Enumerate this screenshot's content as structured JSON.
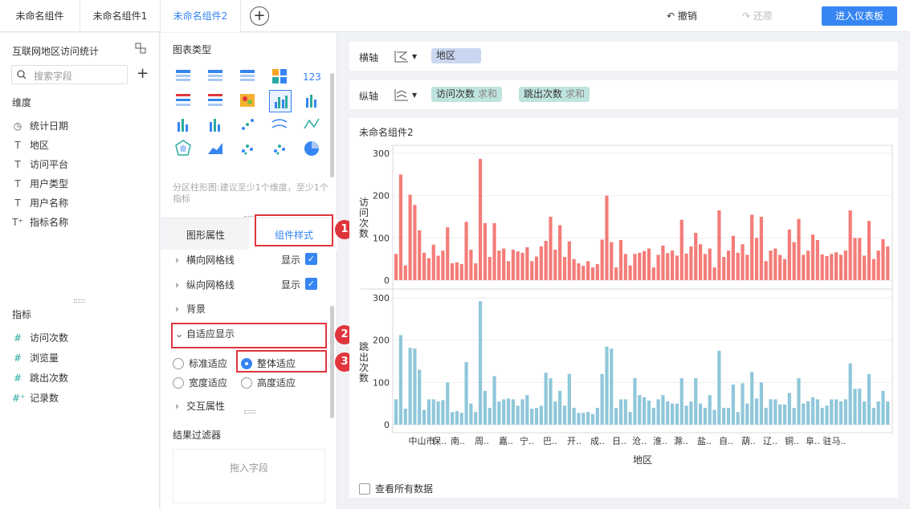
{
  "tabs": [
    "未命名组件",
    "未命名组件1",
    "未命名组件2"
  ],
  "active_tab": 2,
  "toolbar": {
    "undo": "撤销",
    "redo": "还原",
    "enter": "进入仪表板"
  },
  "left": {
    "dataset": "互联网地区访问统计",
    "search_placeholder": "搜索字段",
    "dimensions_title": "维度",
    "dimensions": [
      {
        "icon": "clock-icon",
        "glyph": "◷",
        "label": "统计日期"
      },
      {
        "icon": "text-icon",
        "glyph": "T",
        "label": "地区"
      },
      {
        "icon": "text-icon",
        "glyph": "T",
        "label": "访问平台"
      },
      {
        "icon": "text-icon",
        "glyph": "T",
        "label": "用户类型"
      },
      {
        "icon": "text-icon",
        "glyph": "T",
        "label": "用户名称"
      },
      {
        "icon": "text-plus-icon",
        "glyph": "T⁺",
        "label": "指标名称"
      }
    ],
    "measures_title": "指标",
    "measures": [
      {
        "icon": "hash-icon",
        "glyph": "#",
        "label": "访问次数"
      },
      {
        "icon": "hash-icon",
        "glyph": "#",
        "label": "浏览量"
      },
      {
        "icon": "hash-icon",
        "glyph": "#",
        "label": "跳出次数"
      },
      {
        "icon": "hash-plus-icon",
        "glyph": "#⁺",
        "label": "记录数"
      }
    ]
  },
  "middle": {
    "chart_type_title": "图表类型",
    "hint": "分区柱形图:建议至少1个维度，至少1个指标",
    "tab_props": "图形属性",
    "tab_style": "组件样式",
    "props": {
      "h_grid": "横向网格线",
      "v_grid": "纵向网格线",
      "show": "显示",
      "background": "背景",
      "adaptive": "自适应显示",
      "opt_standard": "标准适应",
      "opt_whole": "整体适应",
      "opt_width": "宽度适应",
      "opt_height": "高度适应",
      "interaction": "交互属性"
    },
    "filter_title": "结果过滤器",
    "drop_hint": "拖入字段"
  },
  "badges": [
    "1",
    "2",
    "3"
  ],
  "axes": {
    "x_label": "横轴",
    "x_field": "地区",
    "y_label": "纵轴",
    "y_fields": [
      {
        "name": "访问次数",
        "agg": "求和"
      },
      {
        "name": "跳出次数",
        "agg": "求和"
      }
    ]
  },
  "chart_title": "未命名组件2",
  "see_all": "查看所有数据",
  "colors": {
    "accent": "#3685f2",
    "bar_top": "#f47c78",
    "bar_bottom": "#8fc7da",
    "badge": "#e0353d"
  },
  "chart_data": {
    "type": "bar",
    "title": "未命名组件2",
    "xlabel": "地区",
    "panels": [
      {
        "ylabel": "访问次数",
        "ylim": [
          0,
          300
        ],
        "yticks": [
          0,
          100,
          200,
          300
        ]
      },
      {
        "ylabel": "跳出次数",
        "ylim": [
          0,
          300
        ],
        "yticks": [
          0,
          100,
          200,
          300
        ]
      }
    ],
    "x_tick_labels": [
      "中山市",
      "保..",
      "南..",
      "周..",
      "嘉..",
      "宁..",
      "巴..",
      "开..",
      "成..",
      "日..",
      "沧..",
      "淮..",
      "滁..",
      "盐..",
      "自..",
      "葫..",
      "辽..",
      "铜..",
      "阜..",
      "驻马.."
    ],
    "series": [
      {
        "name": "访问次数",
        "values": [
          62,
          250,
          35,
          202,
          178,
          118,
          65,
          52,
          84,
          58,
          70,
          125,
          40,
          42,
          38,
          138,
          72,
          40,
          287,
          135,
          55,
          135,
          70,
          75,
          45,
          72,
          68,
          65,
          78,
          45,
          56,
          80,
          93,
          150,
          72,
          130,
          55,
          92,
          50,
          40,
          34,
          45,
          30,
          38,
          96,
          200,
          90,
          30,
          95,
          62,
          35,
          62,
          65,
          69,
          75,
          30,
          60,
          82,
          64,
          70,
          58,
          143,
          63,
          80,
          112,
          85,
          62,
          75,
          30,
          165,
          55,
          70,
          105,
          65,
          85,
          60,
          155,
          100,
          150,
          45,
          70,
          75,
          60,
          50,
          120,
          90,
          145,
          60,
          70,
          108,
          95,
          61,
          57,
          62,
          66,
          60,
          70,
          165,
          100,
          100,
          58,
          140,
          50,
          70,
          97,
          80
        ]
      },
      {
        "name": "跳出次数",
        "values": [
          60,
          212,
          38,
          182,
          180,
          130,
          35,
          60,
          60,
          55,
          58,
          100,
          30,
          32,
          28,
          148,
          50,
          30,
          292,
          80,
          40,
          115,
          55,
          60,
          62,
          60,
          45,
          60,
          70,
          38,
          40,
          45,
          123,
          110,
          55,
          80,
          45,
          120,
          40,
          28,
          28,
          30,
          25,
          40,
          120,
          185,
          180,
          40,
          60,
          60,
          30,
          110,
          70,
          65,
          57,
          40,
          60,
          70,
          55,
          50,
          50,
          110,
          45,
          55,
          110,
          50,
          40,
          70,
          35,
          175,
          40,
          40,
          95,
          30,
          98,
          50,
          125,
          62,
          100,
          40,
          60,
          60,
          48,
          48,
          75,
          40,
          110,
          50,
          55,
          65,
          60,
          40,
          45,
          60,
          60,
          55,
          60,
          145,
          85,
          85,
          55,
          120,
          40,
          55,
          80,
          55
        ]
      }
    ]
  }
}
